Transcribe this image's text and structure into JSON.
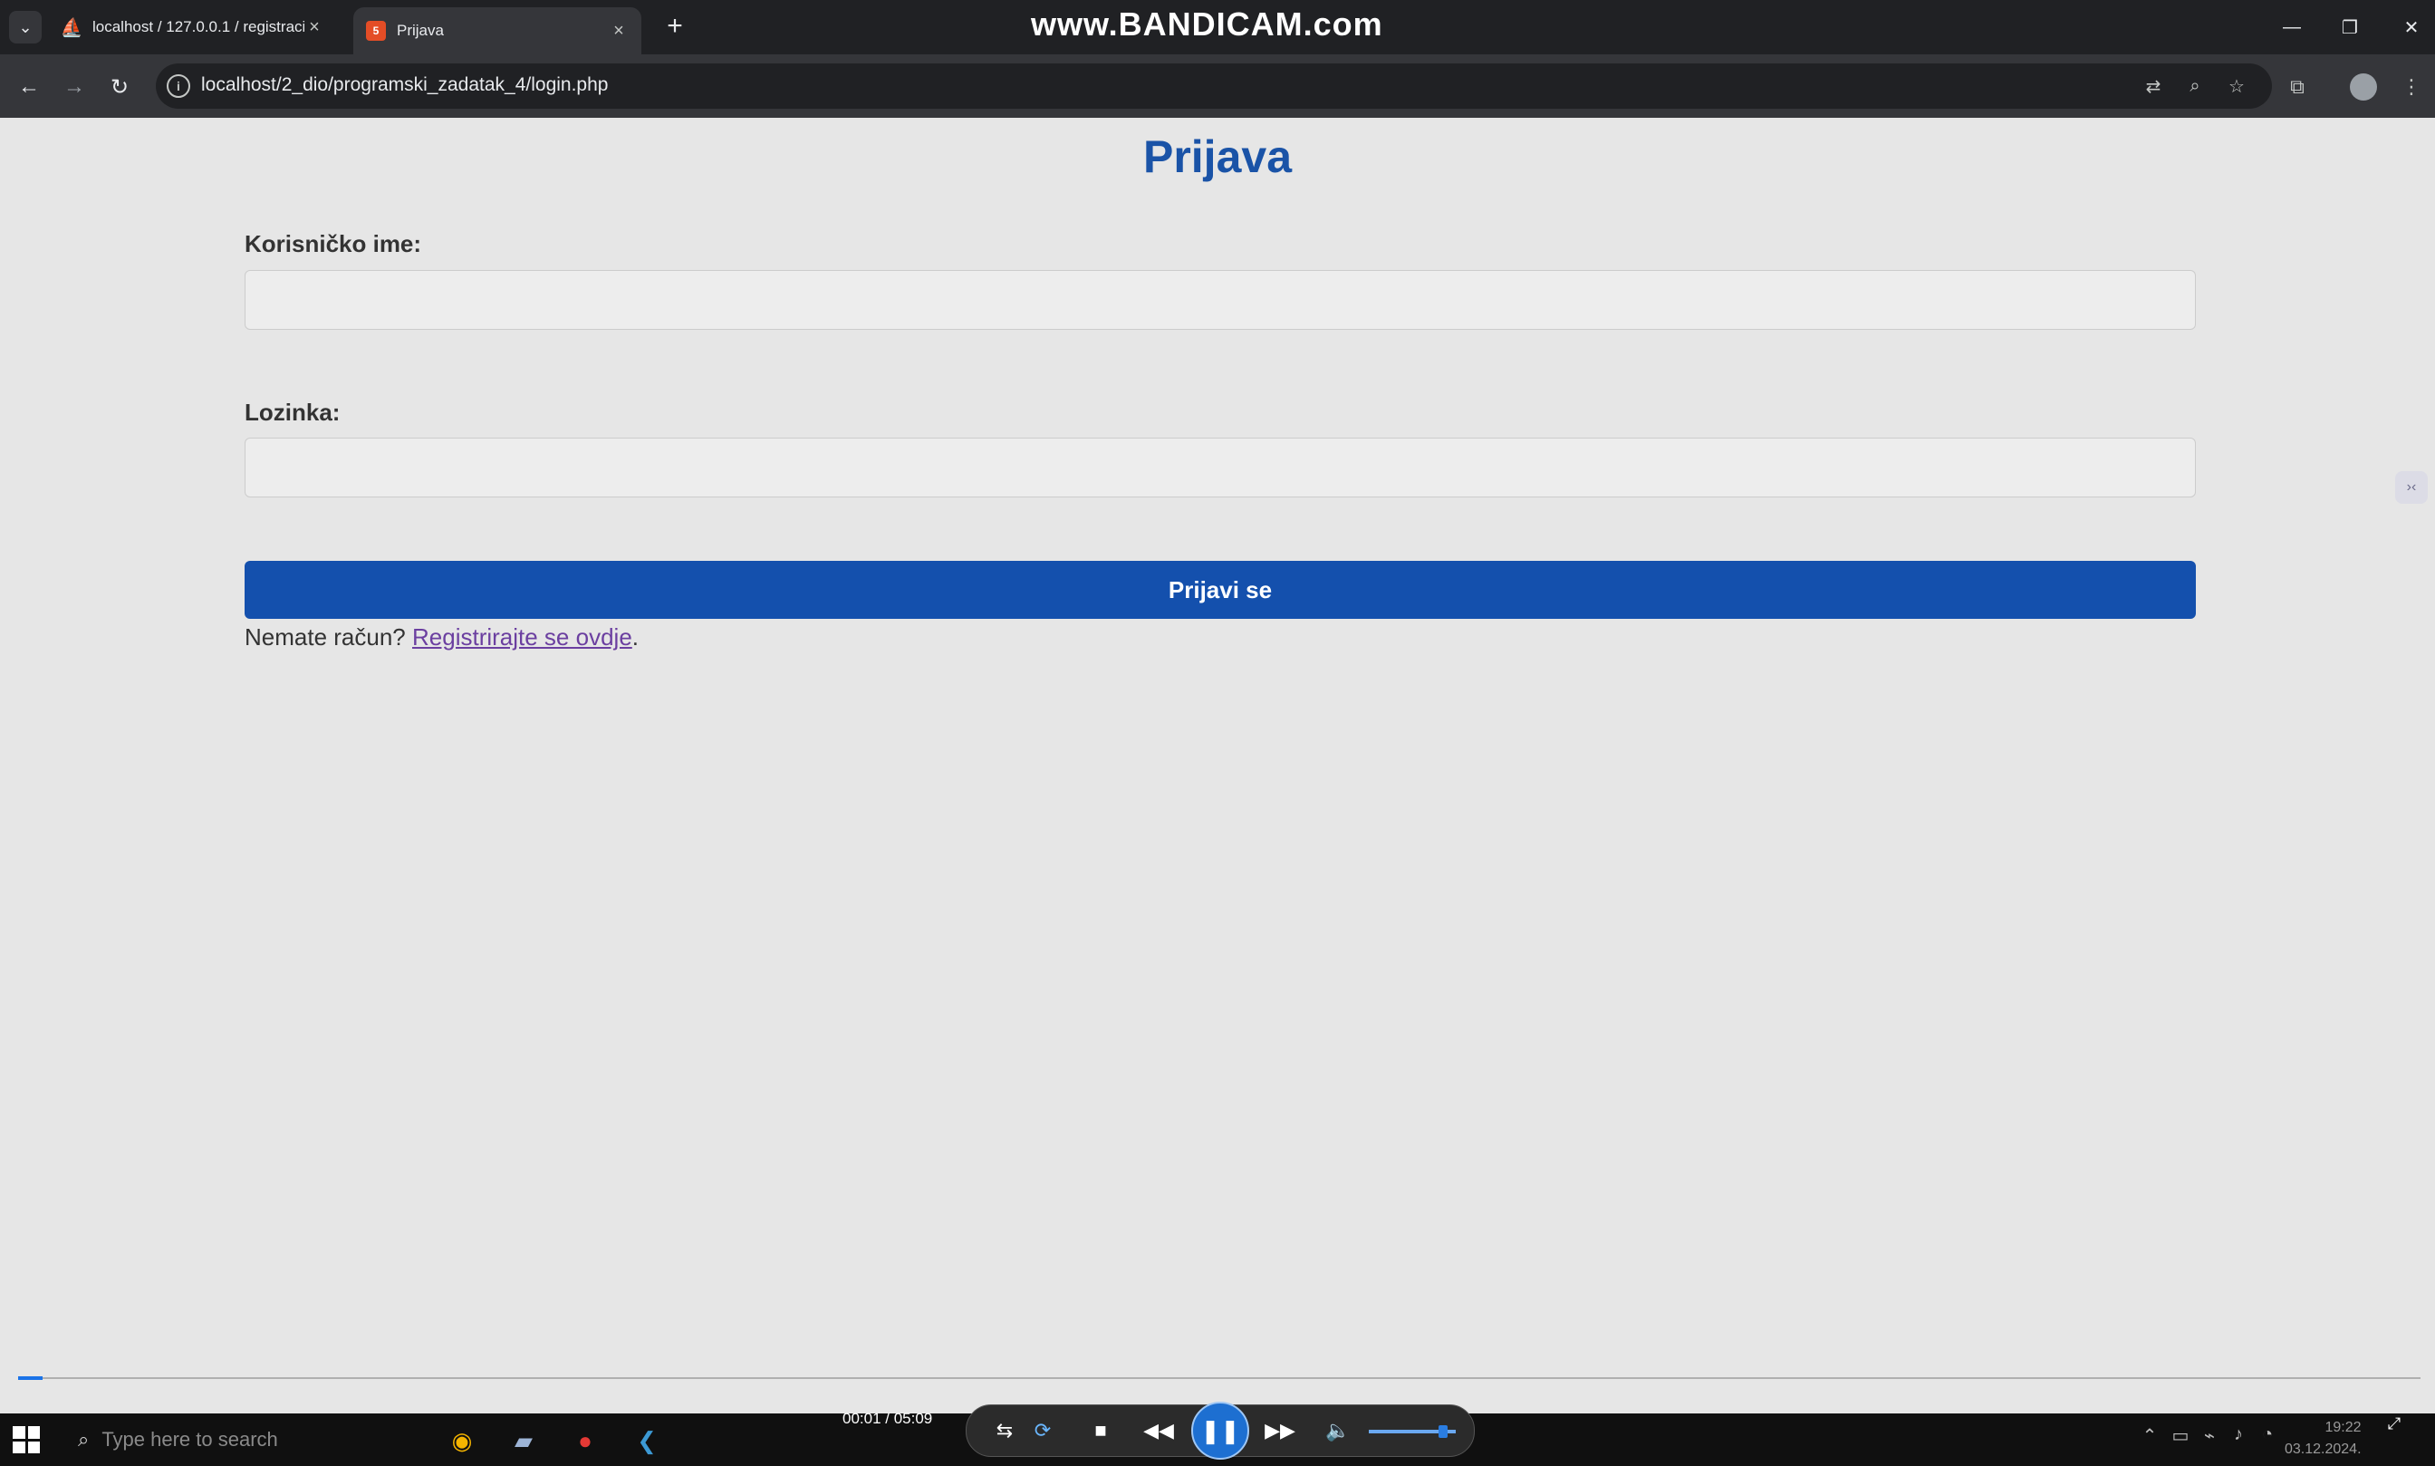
{
  "browser": {
    "tabs": [
      {
        "title": "localhost / 127.0.0.1 / registraci",
        "favicon": "phpmyadmin-icon",
        "active": false
      },
      {
        "title": "Prijava",
        "favicon": "html-file-icon",
        "active": true
      }
    ],
    "address": "localhost/2_dio/programski_zadatak_4/login.php",
    "recorder_watermark": "www.BANDICAM.com"
  },
  "page": {
    "heading": "Prijava",
    "username_label": "Korisničko ime:",
    "username_value": "",
    "password_label": "Lozinka:",
    "password_value": "",
    "submit_label": "Prijavi se",
    "register_prompt": "Nemate račun?",
    "register_link": "Registrirajte se ovdje",
    "register_suffix": "."
  },
  "player": {
    "time": "00:01 / 05:09",
    "progress_fraction": 0.003,
    "volume_fraction": 0.9
  },
  "taskbar": {
    "search_placeholder": "Type here to search",
    "time": "19:22",
    "date": "03.12.2024."
  },
  "colors": {
    "accent": "#1450ad",
    "heading": "#1a53a7",
    "link": "#6b3fa0",
    "page_bg": "#e6e6e6"
  }
}
